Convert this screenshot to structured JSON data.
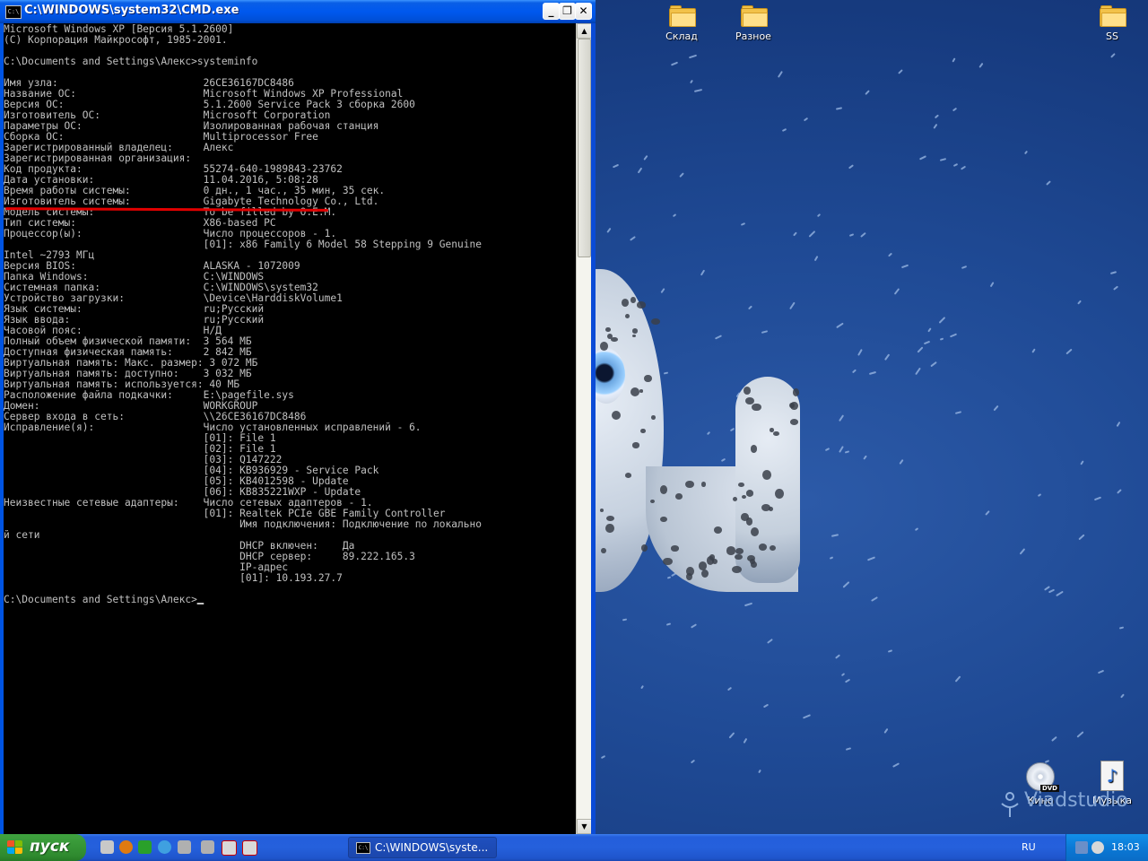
{
  "window": {
    "title": "C:\\WINDOWS\\system32\\CMD.exe",
    "icon_text": "C:\\",
    "minimize_glyph": "_",
    "maximize_glyph": "❐",
    "close_glyph": "✕",
    "scroll_up": "▲",
    "scroll_down": "▼"
  },
  "console": {
    "lines": [
      "Microsoft Windows XP [Версия 5.1.2600]",
      "(С) Корпорация Майкрософт, 1985-2001.",
      "",
      "C:\\Documents and Settings\\Алекс>systeminfo",
      "",
      "Имя узла:                        26CE36167DC8486",
      "Название ОС:                     Microsoft Windows XP Professional",
      "Версия ОС:                       5.1.2600 Service Pack 3 сборка 2600",
      "Изготовитель ОС:                 Microsoft Corporation",
      "Параметры ОС:                    Изолированная рабочая станция",
      "Сборка ОС:                       Multiprocessor Free",
      "Зарегистрированный владелец:     Алекс",
      "Зарегистрированная организация:",
      "Код продукта:                    55274-640-1989843-23762",
      "Дата установки:                  11.04.2016, 5:08:28",
      "Время работы системы:            0 дн., 1 час., 35 мин, 35 сек.",
      "Изготовитель системы:            Gigabyte Technology Co., Ltd.",
      "Модель системы:                  To be filled by O.E.M.",
      "Тип системы:                     X86-based PC",
      "Процессор(ы):                    Число процессоров - 1.",
      "                                 [01]: x86 Family 6 Model 58 Stepping 9 Genuine",
      "Intel ~2793 МГц",
      "Версия BIOS:                     ALASKA - 1072009",
      "Папка Windows:                   C:\\WINDOWS",
      "Системная папка:                 C:\\WINDOWS\\system32",
      "Устройство загрузки:             \\Device\\HarddiskVolume1",
      "Язык системы:                    ru;Русский",
      "Язык ввода:                      ru;Русский",
      "Часовой пояс:                    Н/Д",
      "Полный объем физической памяти:  3 564 МБ",
      "Доступная физическая память:     2 842 МБ",
      "Виртуальная память: Макс. размер: 3 072 МБ",
      "Виртуальная память: доступно:    3 032 МБ",
      "Виртуальная память: используется: 40 МБ",
      "Расположение файла подкачки:     E:\\pagefile.sys",
      "Домен:                           WORKGROUP",
      "Сервер входа в сеть:             \\\\26CE36167DC8486",
      "Исправление(я):                  Число установленных исправлений - 6.",
      "                                 [01]: File 1",
      "                                 [02]: File 1",
      "                                 [03]: Q147222",
      "                                 [04]: KB936929 - Service Pack",
      "                                 [05]: KB4012598 - Update",
      "                                 [06]: KB835221WXP - Update",
      "Неизвестные сетевые адаптеры:    Число сетевых адаптеров - 1.",
      "                                 [01]: Realtek PCIe GBE Family Controller",
      "                                       Имя подключения: Подключение по локально",
      "й сети",
      "                                       DHCP включен:    Да",
      "                                       DHCP сервер:     89.222.165.3",
      "                                       IP-адрес",
      "                                       [01]: 10.193.27.7",
      "",
      "C:\\Documents and Settings\\Алекс>"
    ]
  },
  "desktop": {
    "icons": [
      {
        "label": "Склад",
        "type": "folder-icon"
      },
      {
        "label": "Разное",
        "type": "folder-icon"
      },
      {
        "label": "SS",
        "type": "folder-icon"
      },
      {
        "label": "Кино",
        "type": "dvd-icon",
        "badge": "DVD"
      },
      {
        "label": "Музыка",
        "type": "music-icon",
        "glyph": "♪"
      }
    ],
    "watermark": "Viadstudio"
  },
  "taskbar": {
    "start_label": "пуск",
    "task_button_label": "C:\\WINDOWS\\syste...",
    "task_button_icon": "C:\\",
    "language": "RU",
    "clock": "18:03"
  },
  "colors": {
    "console_bg": "#000000",
    "console_text": "#c0c0c0",
    "highlight_line": "#e10000",
    "titlebar": "#0058ee",
    "taskbar": "#245edb",
    "start_button": "#379737"
  }
}
